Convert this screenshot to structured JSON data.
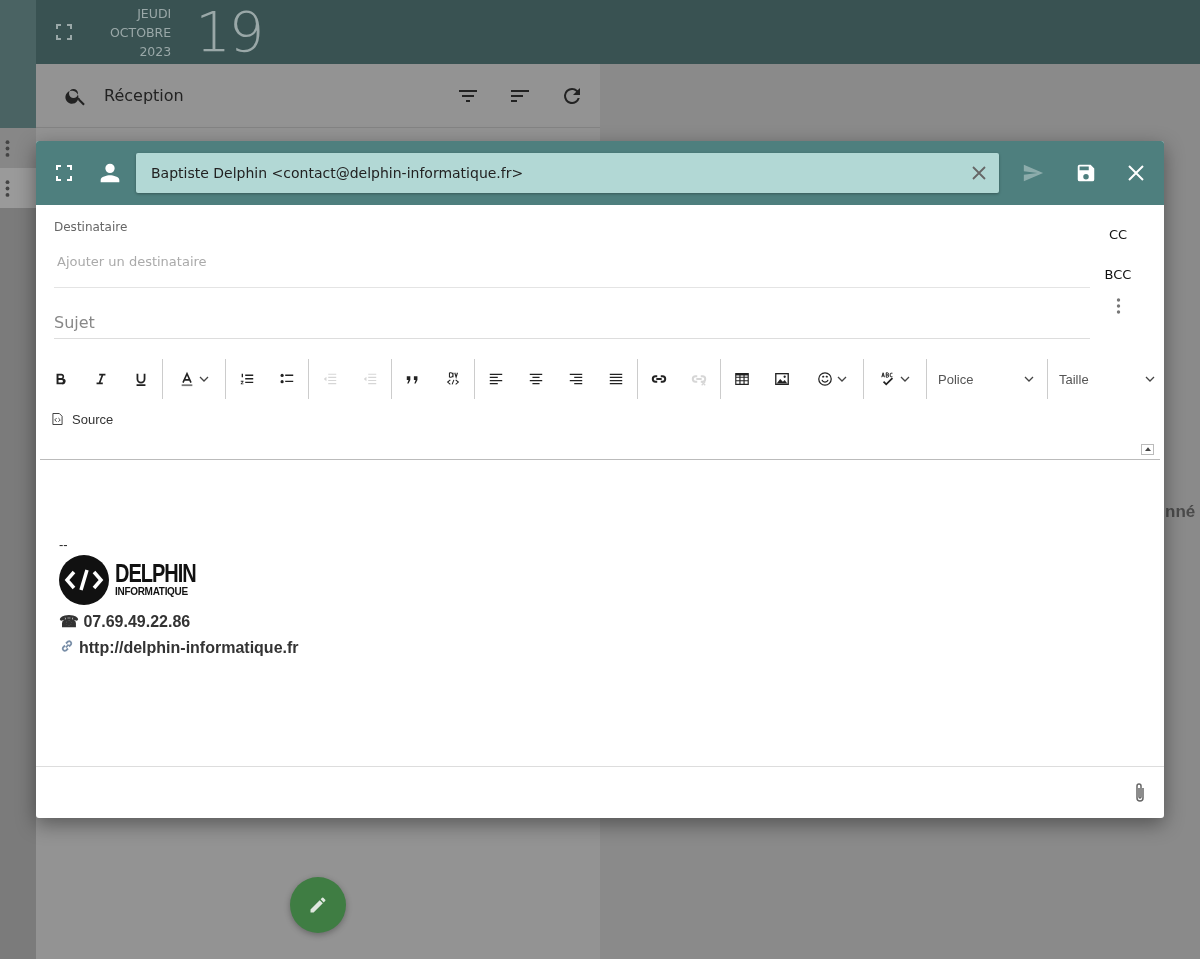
{
  "header": {
    "weekday": "JEUDI",
    "month": "OCTOBRE",
    "year": "2023",
    "day": "19"
  },
  "mail_list": {
    "folder": "Réception"
  },
  "background_text": "nné",
  "compose": {
    "from": "Baptiste Delphin <contact@delphin-informatique.fr>",
    "send_disabled": true,
    "to_label": "Destinataire",
    "to_placeholder": "Ajouter un destinataire",
    "cc": "CC",
    "bcc": "BCC",
    "subject_placeholder": "Sujet",
    "toolbar": [
      [
        {
          "kind": "bold",
          "disabled": false,
          "menu": false
        },
        {
          "kind": "italic",
          "disabled": false,
          "menu": false
        },
        {
          "kind": "underline",
          "disabled": false,
          "menu": false
        }
      ],
      [
        {
          "kind": "textcolor",
          "disabled": false,
          "menu": true
        }
      ],
      [
        {
          "kind": "numbered",
          "disabled": false,
          "menu": false
        },
        {
          "kind": "bulleted",
          "disabled": false,
          "menu": false
        }
      ],
      [
        {
          "kind": "outdent",
          "disabled": true,
          "menu": false
        },
        {
          "kind": "indent",
          "disabled": true,
          "menu": false
        }
      ],
      [
        {
          "kind": "quote",
          "disabled": false,
          "menu": false
        },
        {
          "kind": "div",
          "disabled": false,
          "menu": false
        }
      ],
      [
        {
          "kind": "left",
          "disabled": false,
          "menu": false
        },
        {
          "kind": "center",
          "disabled": false,
          "menu": false
        },
        {
          "kind": "right",
          "disabled": false,
          "menu": false
        },
        {
          "kind": "justify",
          "disabled": false,
          "menu": false
        }
      ],
      [
        {
          "kind": "link",
          "disabled": false,
          "menu": false
        },
        {
          "kind": "unlink",
          "disabled": true,
          "menu": false
        }
      ],
      [
        {
          "kind": "table",
          "disabled": false,
          "menu": false
        },
        {
          "kind": "image",
          "disabled": false,
          "menu": false
        },
        {
          "kind": "emoji",
          "disabled": false,
          "menu": true
        }
      ],
      [
        {
          "kind": "spell",
          "disabled": false,
          "menu": true
        }
      ],
      [
        {
          "kind": "select",
          "label": "Police",
          "disabled": false,
          "menu": true
        }
      ],
      [
        {
          "kind": "select",
          "label": "Taille",
          "disabled": false,
          "menu": true
        }
      ]
    ],
    "source": "Source",
    "signature": {
      "separator": "--",
      "logo_name": "DELPHIN",
      "logo_sub": "INFORMATIQUE",
      "phone": "☎ 07.69.49.22.86",
      "website": "http://delphin-informatique.fr"
    }
  }
}
